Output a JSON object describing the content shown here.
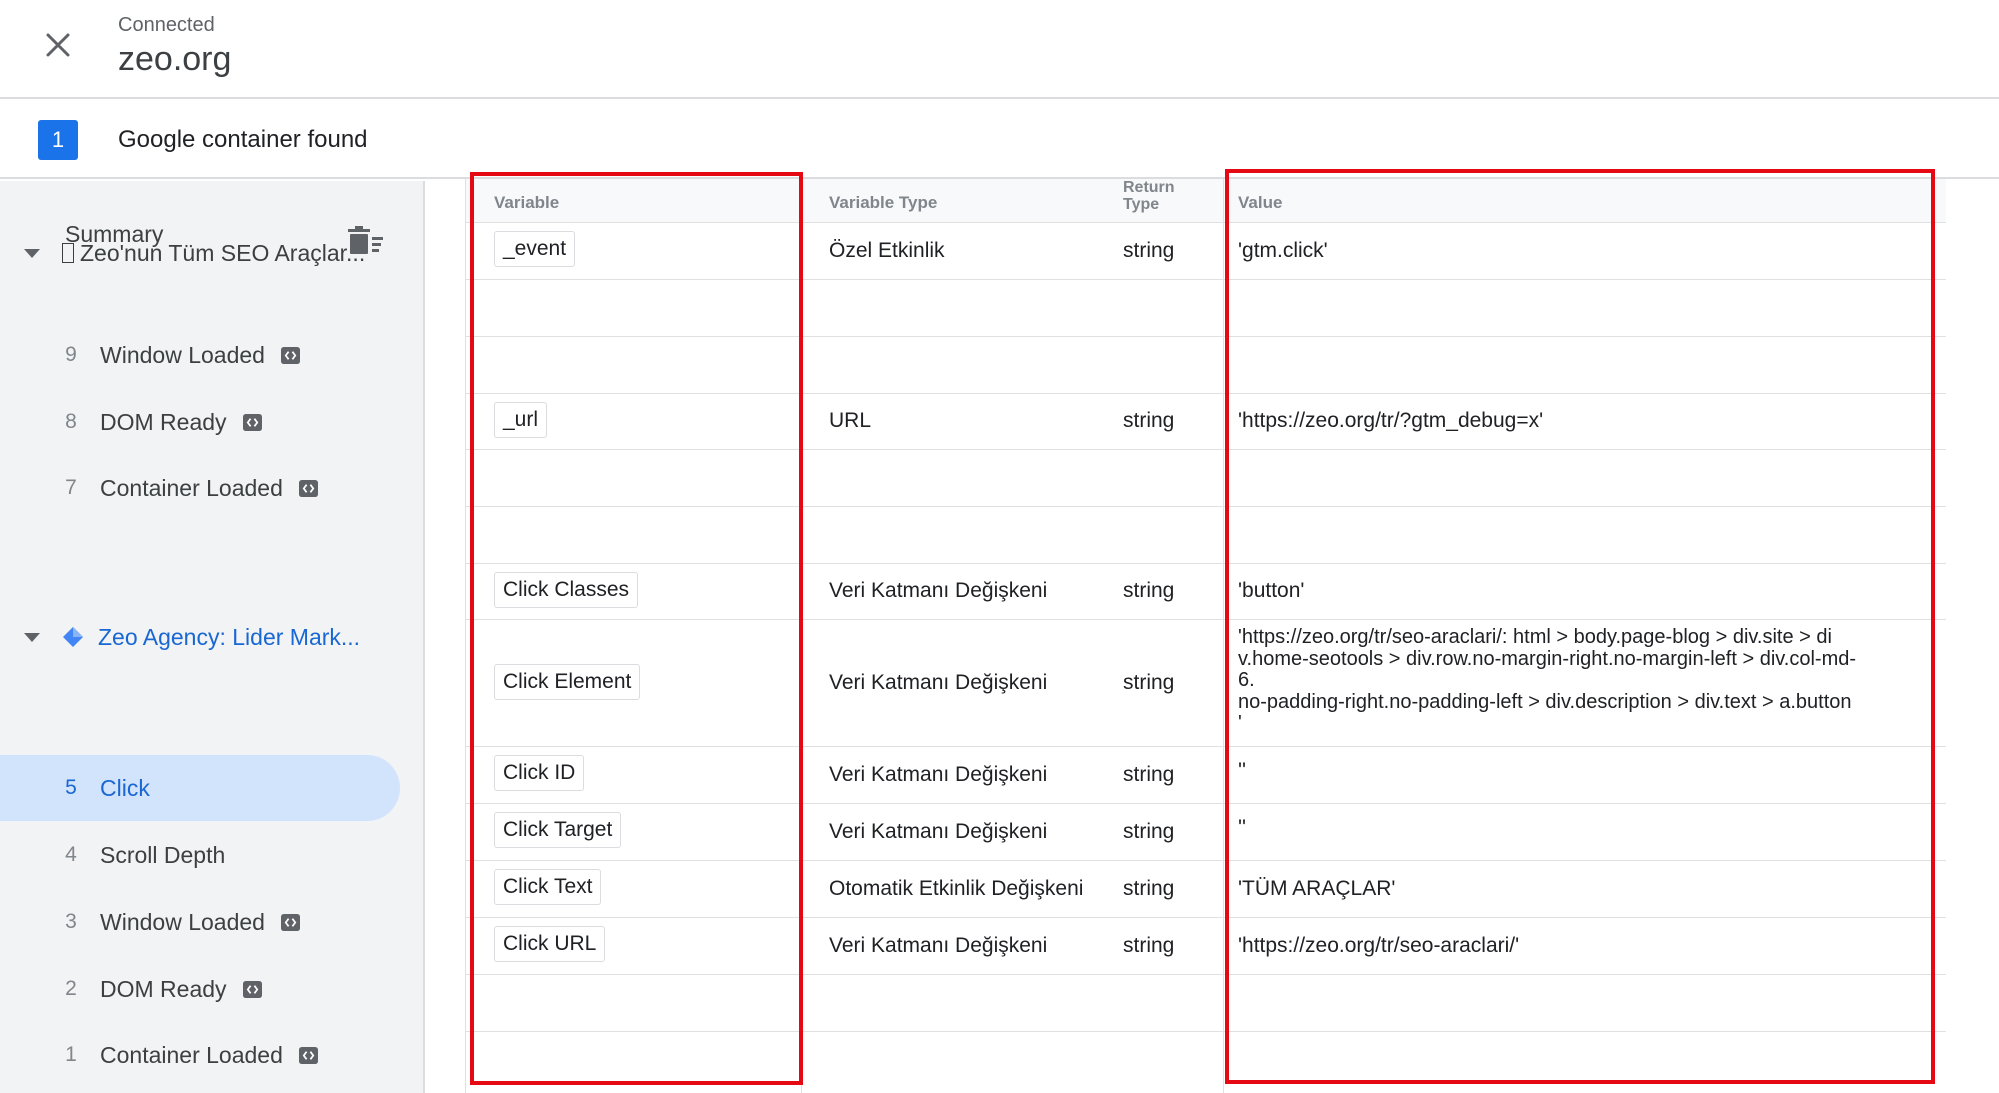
{
  "header": {
    "status": "Connected",
    "site": "zeo.org",
    "container_count": "1",
    "container_found": "Google container found"
  },
  "sidebar": {
    "summary": "Summary",
    "group1_label": "Zeo'nun Tüm SEO Araçlar...",
    "group2_label": "Zeo Agency: Lider Mark...",
    "events_group1": [
      {
        "num": "9",
        "name": "Window Loaded"
      },
      {
        "num": "8",
        "name": "DOM Ready"
      },
      {
        "num": "7",
        "name": "Container Loaded"
      }
    ],
    "events_group2": [
      {
        "num": "5",
        "name": "Click"
      },
      {
        "num": "4",
        "name": "Scroll Depth"
      },
      {
        "num": "3",
        "name": "Window Loaded"
      },
      {
        "num": "2",
        "name": "DOM Ready"
      },
      {
        "num": "1",
        "name": "Container Loaded"
      }
    ],
    "active_event": "Click"
  },
  "table": {
    "headers": {
      "variable": "Variable",
      "variable_type": "Variable Type",
      "return_type_1": "Return",
      "return_type_2": "Type",
      "value": "Value"
    },
    "rows": [
      {
        "variable": "_event",
        "type": "Özel Etkinlik",
        "return": "string",
        "value": "'gtm.click'"
      },
      {
        "variable": "_url",
        "type": "URL",
        "return": "string",
        "value": "'https://zeo.org/tr/?gtm_debug=x'"
      },
      {
        "variable": "Click Classes",
        "type": "Veri Katmanı Değişkeni",
        "return": "string",
        "value": "'button'"
      },
      {
        "variable": "Click Element",
        "type": "Veri Katmanı Değişkeni",
        "return": "string",
        "value": "'https://zeo.org/tr/seo-araclari/: html > body.page-blog > div.site > di\nv.home-seotools > div.row.no-margin-right.no-margin-left > div.col-md-\n6.\nno-padding-right.no-padding-left > div.description > div.text > a.button\n'"
      },
      {
        "variable": "Click ID",
        "type": "Veri Katmanı Değişkeni",
        "return": "string",
        "value": "''"
      },
      {
        "variable": "Click Target",
        "type": "Veri Katmanı Değişkeni",
        "return": "string",
        "value": "''"
      },
      {
        "variable": "Click Text",
        "type": "Otomatik Etkinlik Değişkeni",
        "return": "string",
        "value": "'TÜM ARAÇLAR'"
      },
      {
        "variable": "Click URL",
        "type": "Veri Katmanı Değişkeni",
        "return": "string",
        "value": "'https://zeo.org/tr/seo-araclari/'"
      }
    ]
  },
  "colors": {
    "accent": "#1a73e8",
    "active_bg": "#d2e3fc",
    "highlight": "#e50914"
  },
  "icons": {
    "close": "close-icon",
    "trash": "clear-all-icon",
    "tag": "code-tag-icon",
    "gem": "diamond-icon"
  }
}
